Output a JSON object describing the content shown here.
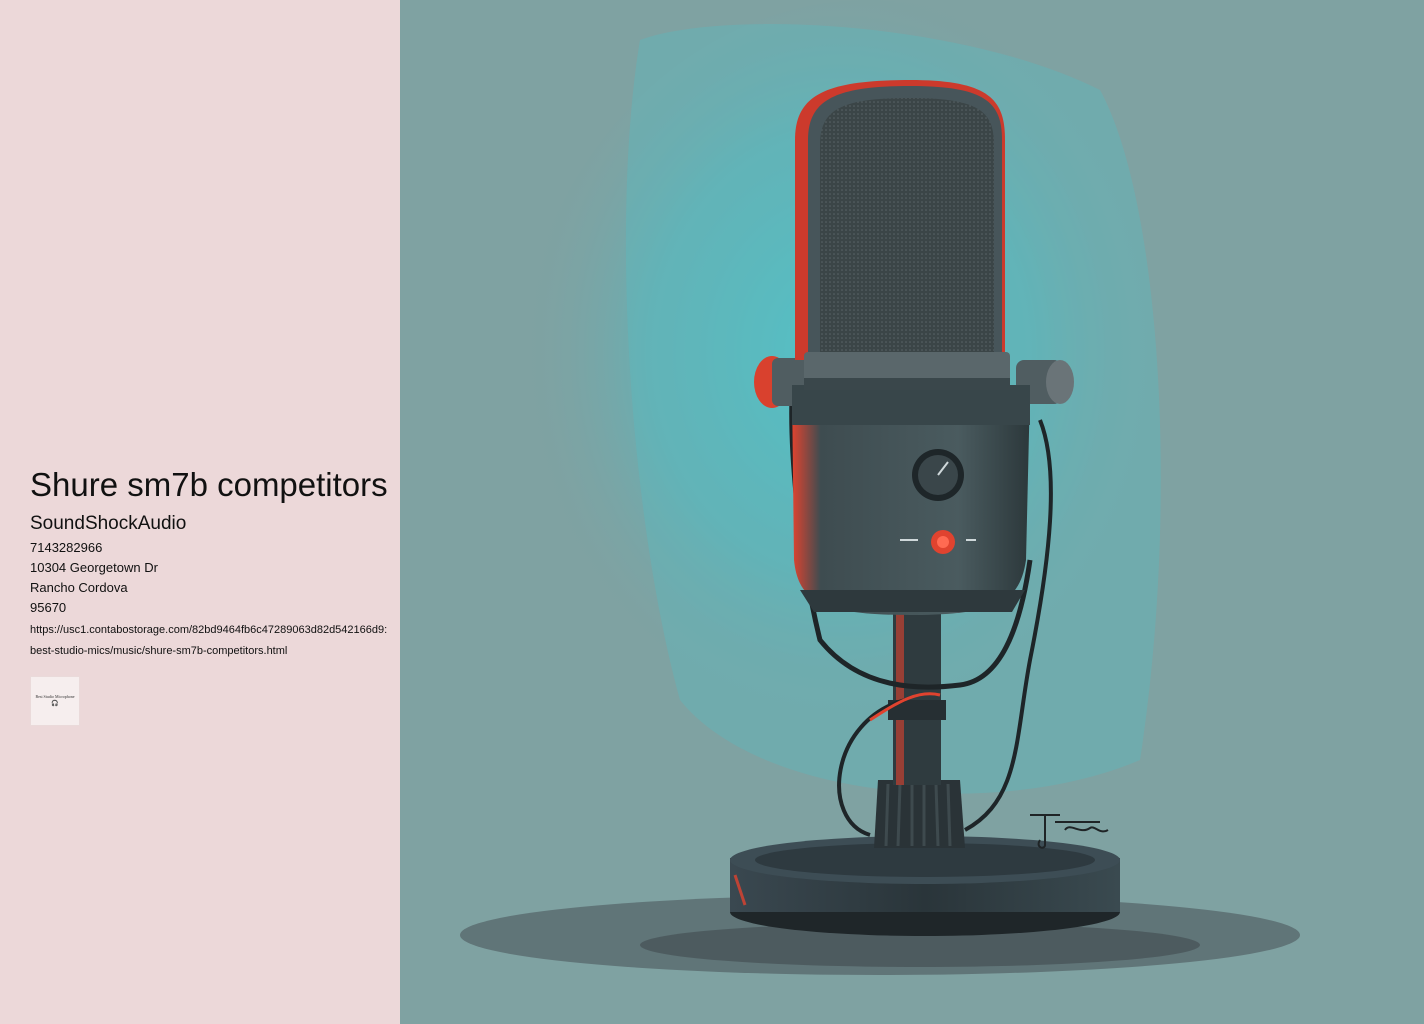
{
  "page": {
    "title": "Shure sm7b competitors",
    "brand": "SoundShockAudio",
    "phone": "7143282966",
    "street": "10304 Georgetown Dr",
    "city": "Rancho Cordova",
    "zip": "95670",
    "url": "https://usc1.contabostorage.com/82bd9464fb6c47289063d82d542166d9:best-studio-mics/music/shure-sm7b-competitors.html"
  },
  "logo": {
    "text": "Best Studio Microphone",
    "icon": "headphones-icon"
  },
  "colors": {
    "sidebar_bg": "#ecd8d9",
    "hero_bg": "#7fa2a2",
    "accent_cyan": "#4fc6cc",
    "accent_red": "#e0432f"
  }
}
